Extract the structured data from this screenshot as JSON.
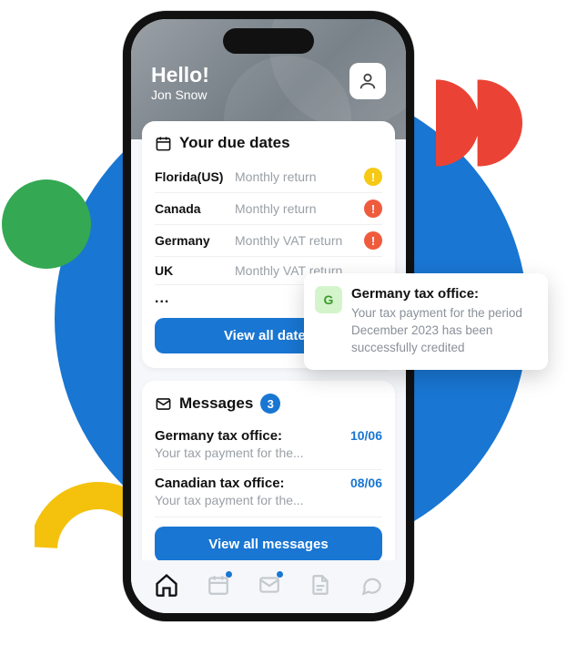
{
  "header": {
    "hello": "Hello!",
    "name": "Jon Snow"
  },
  "due_dates": {
    "title": "Your due dates",
    "items": [
      {
        "region": "Florida(US)",
        "desc": "Monthly return",
        "status": "yellow"
      },
      {
        "region": "Canada",
        "desc": "Monthly return",
        "status": "red"
      },
      {
        "region": "Germany",
        "desc": "Monthly VAT return",
        "status": "red"
      },
      {
        "region": "UK",
        "desc": "Monthly VAT return",
        "status": ""
      }
    ],
    "more": "...",
    "button": "View all dates"
  },
  "messages": {
    "title": "Messages",
    "count": "3",
    "items": [
      {
        "sender": "Germany tax office:",
        "date": "10/06",
        "preview": "Your tax payment for the..."
      },
      {
        "sender": "Canadian tax office:",
        "date": "08/06",
        "preview": "Your tax payment for the..."
      }
    ],
    "button": "View all messages"
  },
  "toast": {
    "icon_letter": "G",
    "title": "Germany tax office:",
    "body": "Your tax payment for the period December 2023 has been successfully credited"
  }
}
